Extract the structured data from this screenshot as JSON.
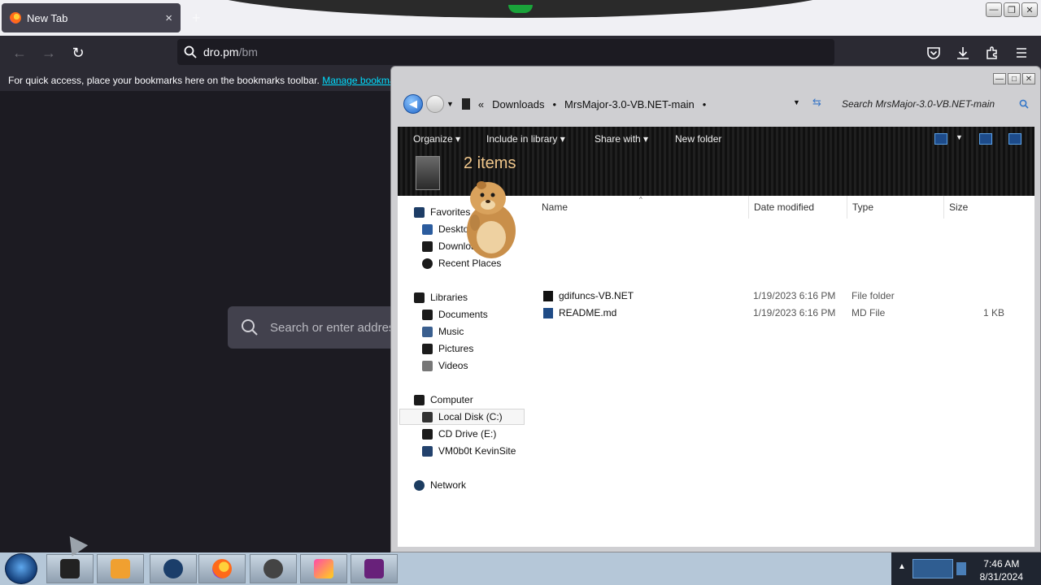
{
  "browser": {
    "tab_title": "New Tab",
    "tab_close": "×",
    "new_tab": "+",
    "url_host": "dro.pm",
    "url_path": "/bm",
    "bookmarks_message": "For quick access, place your bookmarks here on the bookmarks toolbar.",
    "bookmarks_link": "Manage bookmarks",
    "page_search_placeholder": "Search or enter address"
  },
  "explorer": {
    "breadcrumb": [
      "Downloads",
      "MrsMajor-3.0-VB.NET-main"
    ],
    "search_placeholder": "Search MrsMajor-3.0-VB.NET-main",
    "commands": [
      "Organize",
      "Include in library",
      "Share with",
      "New folder"
    ],
    "item_count": "2 items",
    "nav": {
      "favorites": {
        "label": "Favorites",
        "items": [
          "Desktop",
          "Downloads",
          "Recent Places"
        ]
      },
      "libraries": {
        "label": "Libraries",
        "items": [
          "Documents",
          "Music",
          "Pictures",
          "Videos"
        ]
      },
      "computer": {
        "label": "Computer",
        "items": [
          "Local Disk (C:)",
          "CD Drive (E:)",
          "VM0b0t KevinSite"
        ]
      },
      "network": {
        "label": "Network"
      }
    },
    "columns": [
      "Name",
      "Date modified",
      "Type",
      "Size"
    ],
    "files": [
      {
        "name": "gdifuncs-VB.NET",
        "date": "1/19/2023 6:16 PM",
        "type": "File folder",
        "size": ""
      },
      {
        "name": "README.md",
        "date": "1/19/2023 6:16 PM",
        "type": "MD File",
        "size": "1 KB"
      }
    ]
  },
  "taskbar": {
    "time": "7:46 AM",
    "date": "8/31/2024"
  }
}
